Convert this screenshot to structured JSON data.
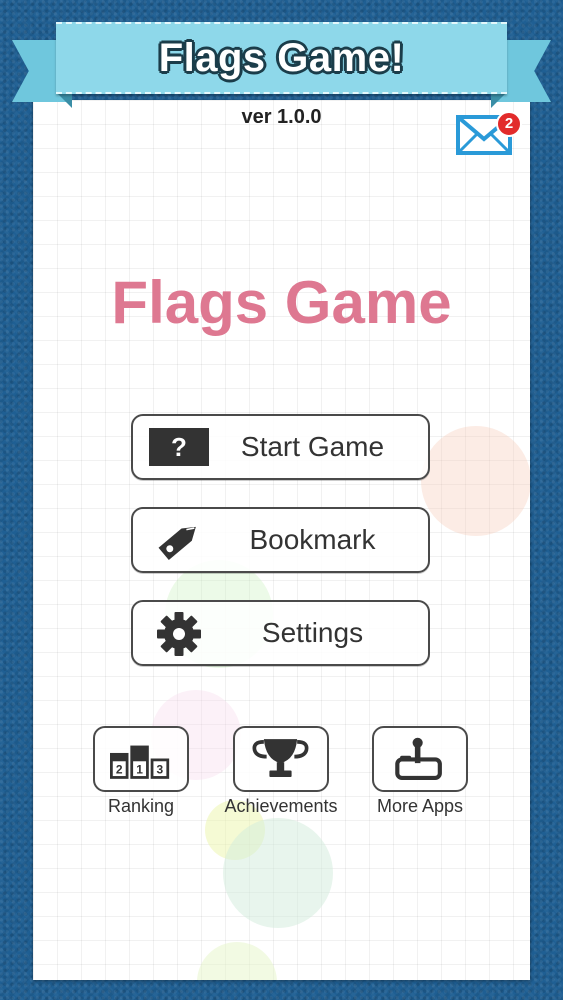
{
  "banner": {
    "title": "Flags Game!"
  },
  "version": "ver 1.0.0",
  "mail": {
    "badge_count": "2"
  },
  "main": {
    "title": "Flags Game"
  },
  "menu": {
    "start_label": "Start Game",
    "bookmark_label": "Bookmark",
    "settings_label": "Settings"
  },
  "bottom": {
    "ranking_label": "Ranking",
    "ranking_digits": [
      "2",
      "1",
      "3"
    ],
    "achievements_label": "Achievements",
    "more_apps_label": "More Apps"
  },
  "icons": {
    "start": "question-mark-icon",
    "bookmark": "tag-pencil-icon",
    "settings": "gear-icon",
    "ranking": "podium-icon",
    "achievements": "trophy-icon",
    "more_apps": "joystick-icon",
    "mail": "envelope-icon"
  },
  "colors": {
    "background": "#1f5f93",
    "ribbon": "#8ed8ea",
    "title_pink": "#de7891",
    "mail_blue": "#2a9ad8",
    "badge_red": "#e22b2b"
  }
}
